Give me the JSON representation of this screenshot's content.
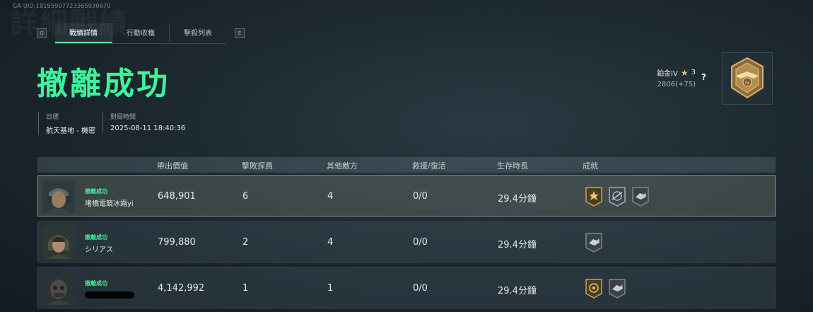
{
  "uid": "GA UID:1819590772336593067​0",
  "background_title": "詳細戰績",
  "tabs": {
    "left_key": "Q",
    "right_key": "E",
    "items": [
      "戰績詳情",
      "行動收穫",
      "擊殺列表"
    ],
    "active": 0
  },
  "result_title": "撤離成功",
  "mission": {
    "target_label": "目標",
    "target_value": "航天基地 - 機密",
    "time_label": "對局時間",
    "time_value": "2025-08-11 18:40:36"
  },
  "rank": {
    "tier": "鉑金IV",
    "stars": "3",
    "points": "2806(+75)",
    "help": "?"
  },
  "table": {
    "headers": [
      "帶出價值",
      "擊敗探員",
      "其他敵方",
      "救援/復活",
      "生存時長",
      "成就"
    ],
    "rows": [
      {
        "status": "撤離成功",
        "name": "堵橋電競冰霜yi",
        "value": "648,901",
        "kills": "6",
        "others": "4",
        "revive": "0/0",
        "time": "29.4分鐘",
        "achievements": [
          "gold-starburst-badge",
          "silver-rifle-badge",
          "gray-hand-badge"
        ],
        "highlight": true,
        "redacted": false
      },
      {
        "status": "撤離成功",
        "name": "シリアス",
        "value": "799,880",
        "kills": "2",
        "others": "4",
        "revive": "0/0",
        "time": "29.4分鐘",
        "achievements": [
          "gray-hand-badge"
        ],
        "highlight": false,
        "redacted": false
      },
      {
        "status": "撤離成功",
        "name": "",
        "value": "4,142,992",
        "kills": "1",
        "others": "1",
        "revive": "0/0",
        "time": "29.4分鐘",
        "achievements": [
          "gold-ring-badge",
          "gray-hand-badge"
        ],
        "highlight": false,
        "redacted": true
      }
    ]
  },
  "colors": {
    "accent_green": "#3ff29c",
    "status_green": "#45e79e",
    "gold": "#c9a14f"
  }
}
